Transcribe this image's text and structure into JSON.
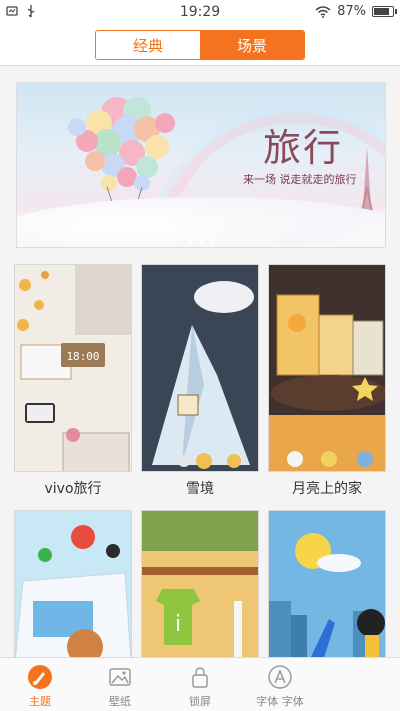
{
  "status_bar": {
    "time": "19:29",
    "battery": "87%"
  },
  "header": {
    "tabs": [
      {
        "label": "经典",
        "active": false
      },
      {
        "label": "场景",
        "active": true
      }
    ]
  },
  "banner": {
    "title": "旅行",
    "subtitle": "来一场 说走就走的旅行"
  },
  "themes": [
    {
      "label": "vivo旅行"
    },
    {
      "label": "雪境"
    },
    {
      "label": "月亮上的家"
    },
    {
      "label": ""
    },
    {
      "label": ""
    },
    {
      "label": ""
    }
  ],
  "bottom_nav": [
    {
      "label": "主题",
      "icon": "theme-brush-icon",
      "active": true
    },
    {
      "label": "壁纸",
      "icon": "wallpaper-image-icon",
      "active": false
    },
    {
      "label": "锁屏",
      "icon": "lock-icon",
      "active": false
    },
    {
      "label": "字体 字体",
      "icon": "font-icon",
      "active": false
    },
    {
      "label": "",
      "icon": "",
      "active": false
    }
  ],
  "colors": {
    "accent": "#f5731e"
  }
}
